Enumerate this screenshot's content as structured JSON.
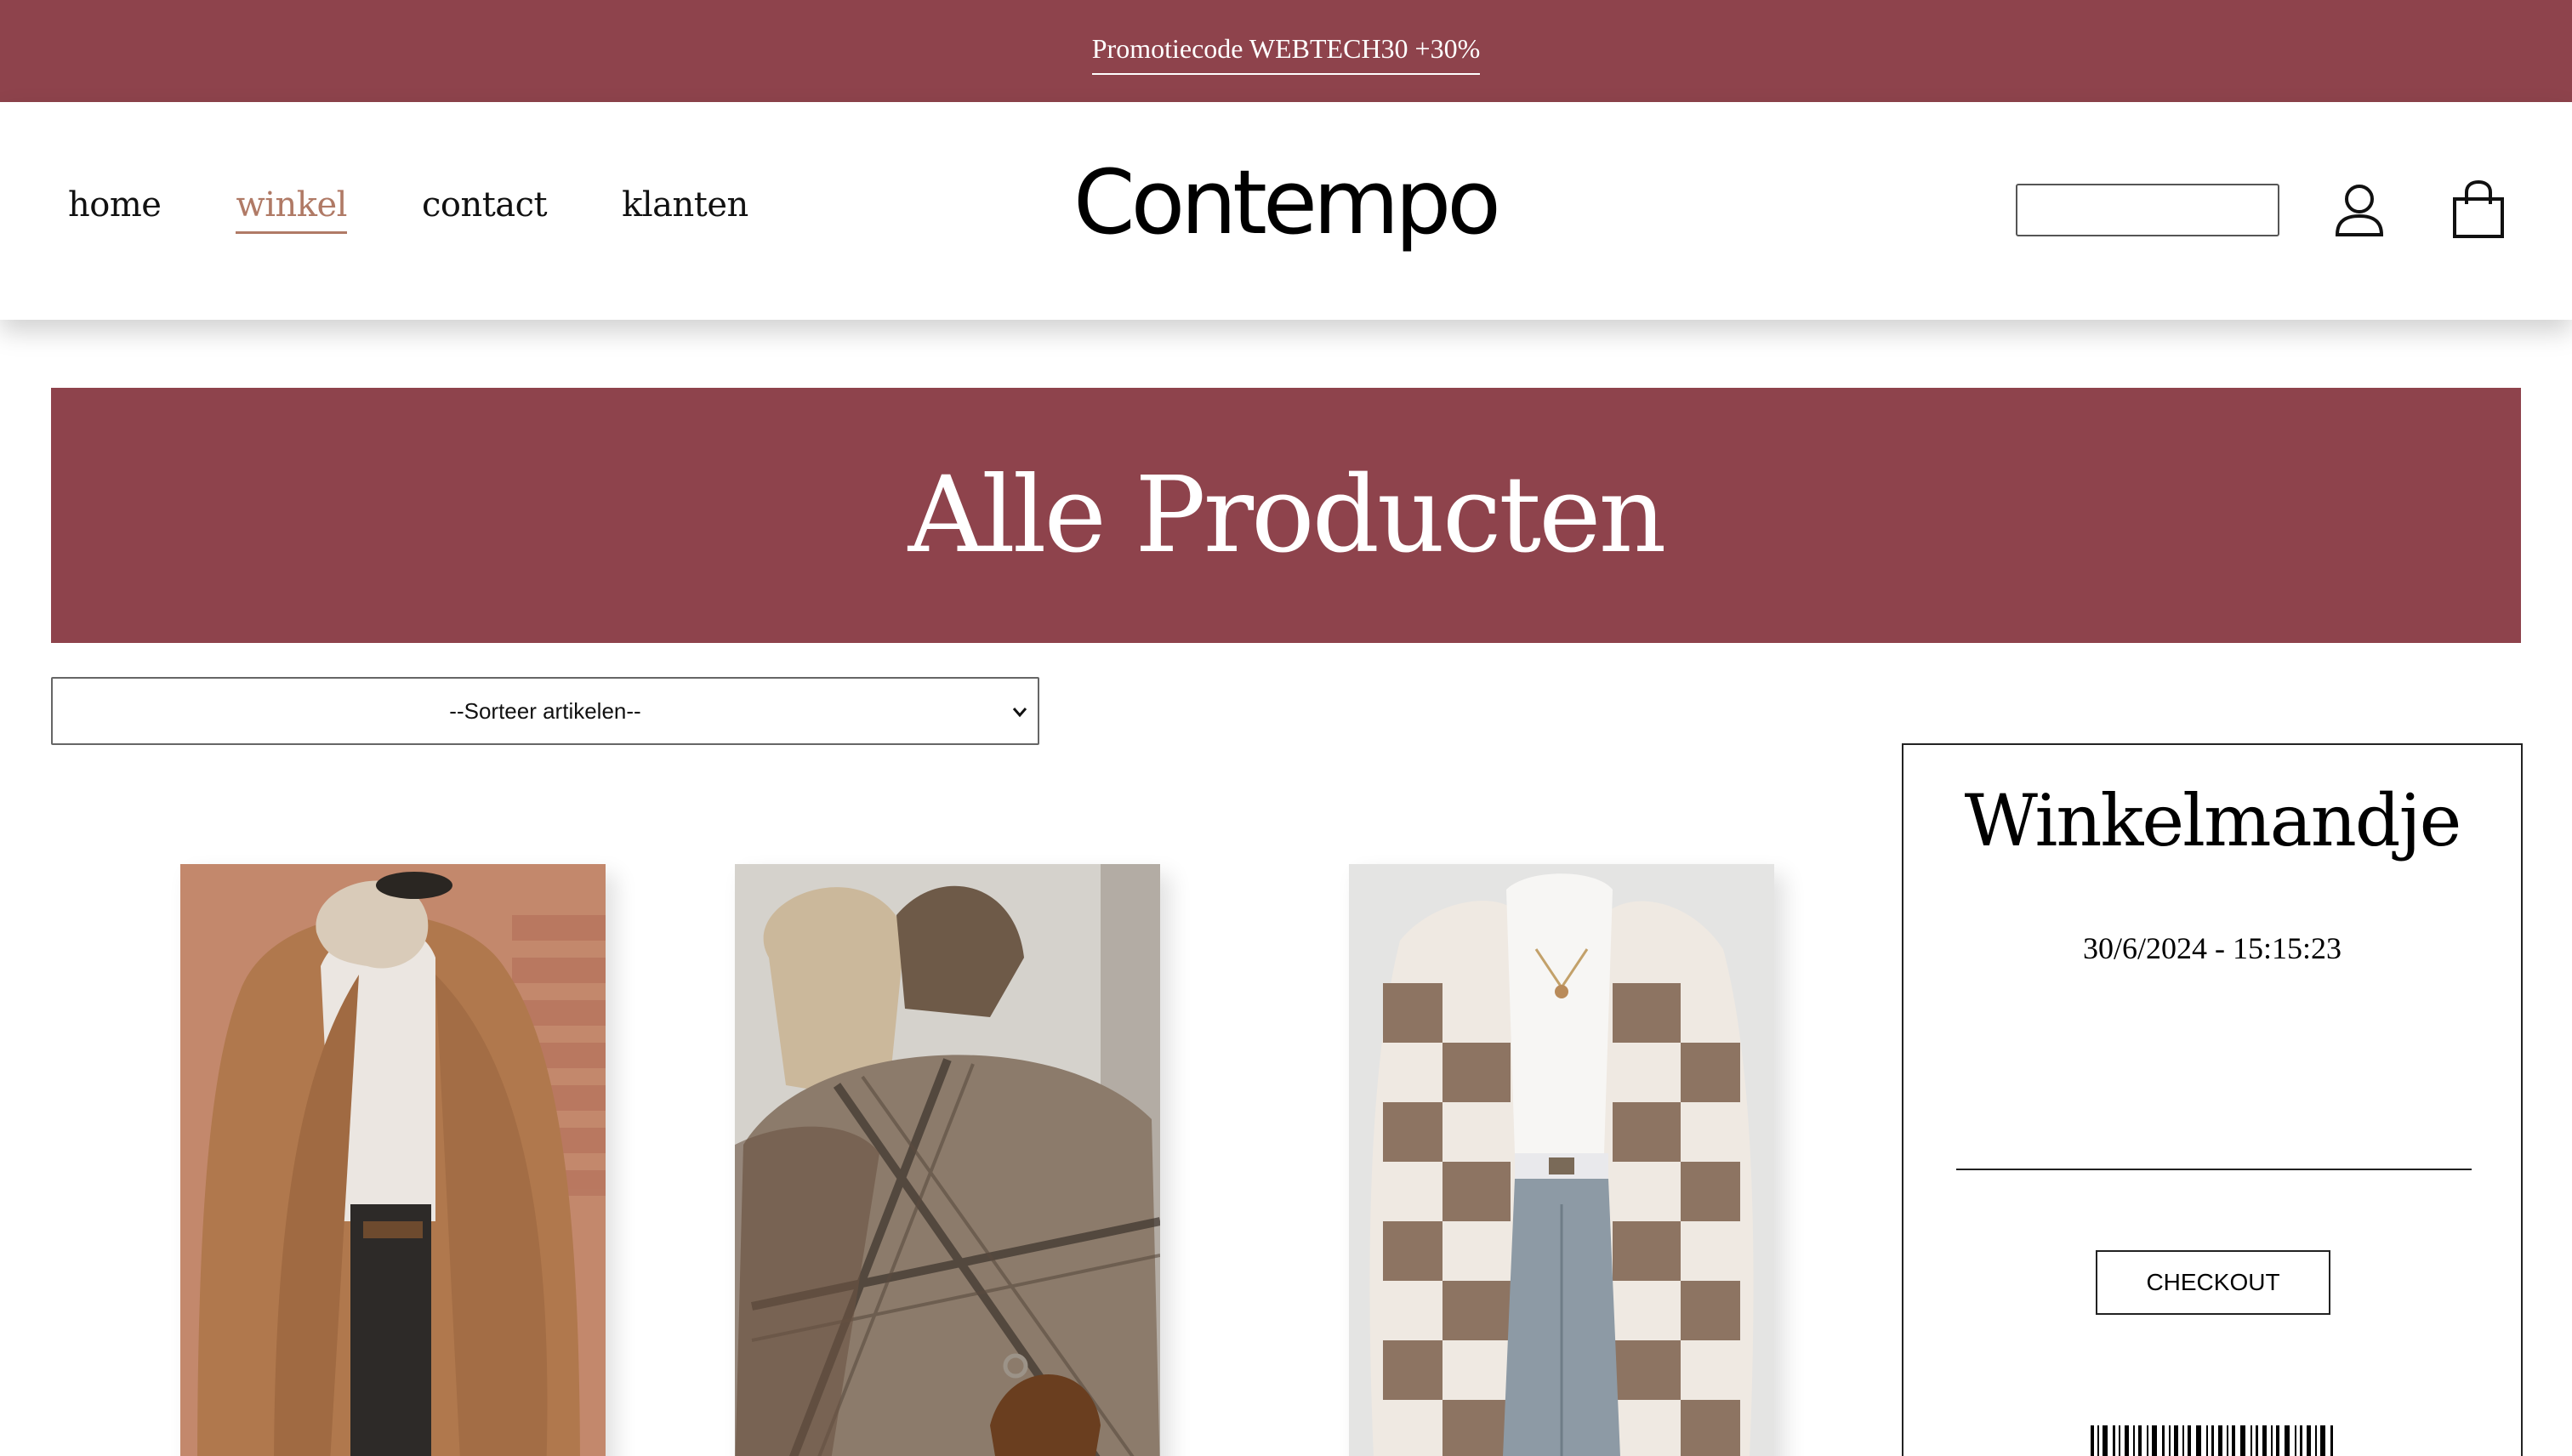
{
  "promo": {
    "text": "Promotiecode WEBTECH30 +30%"
  },
  "nav": {
    "items": [
      "home",
      "winkel",
      "contact",
      "klanten"
    ],
    "active": "winkel"
  },
  "logo": {
    "text": "Contempo"
  },
  "search": {
    "placeholder": ""
  },
  "hero": {
    "title": "Alle Producten"
  },
  "sort": {
    "selected": "--Sorteer artikelen--"
  },
  "cart": {
    "title": "Winkelmandje",
    "datetime": "30/6/2024 - 15:15:23",
    "checkout_label": "CHECKOUT"
  },
  "colors": {
    "brand": "#8e434c",
    "active_link": "#b07a66"
  },
  "icons": [
    "user-icon",
    "shopping-bag-icon",
    "chevron-down-icon"
  ]
}
